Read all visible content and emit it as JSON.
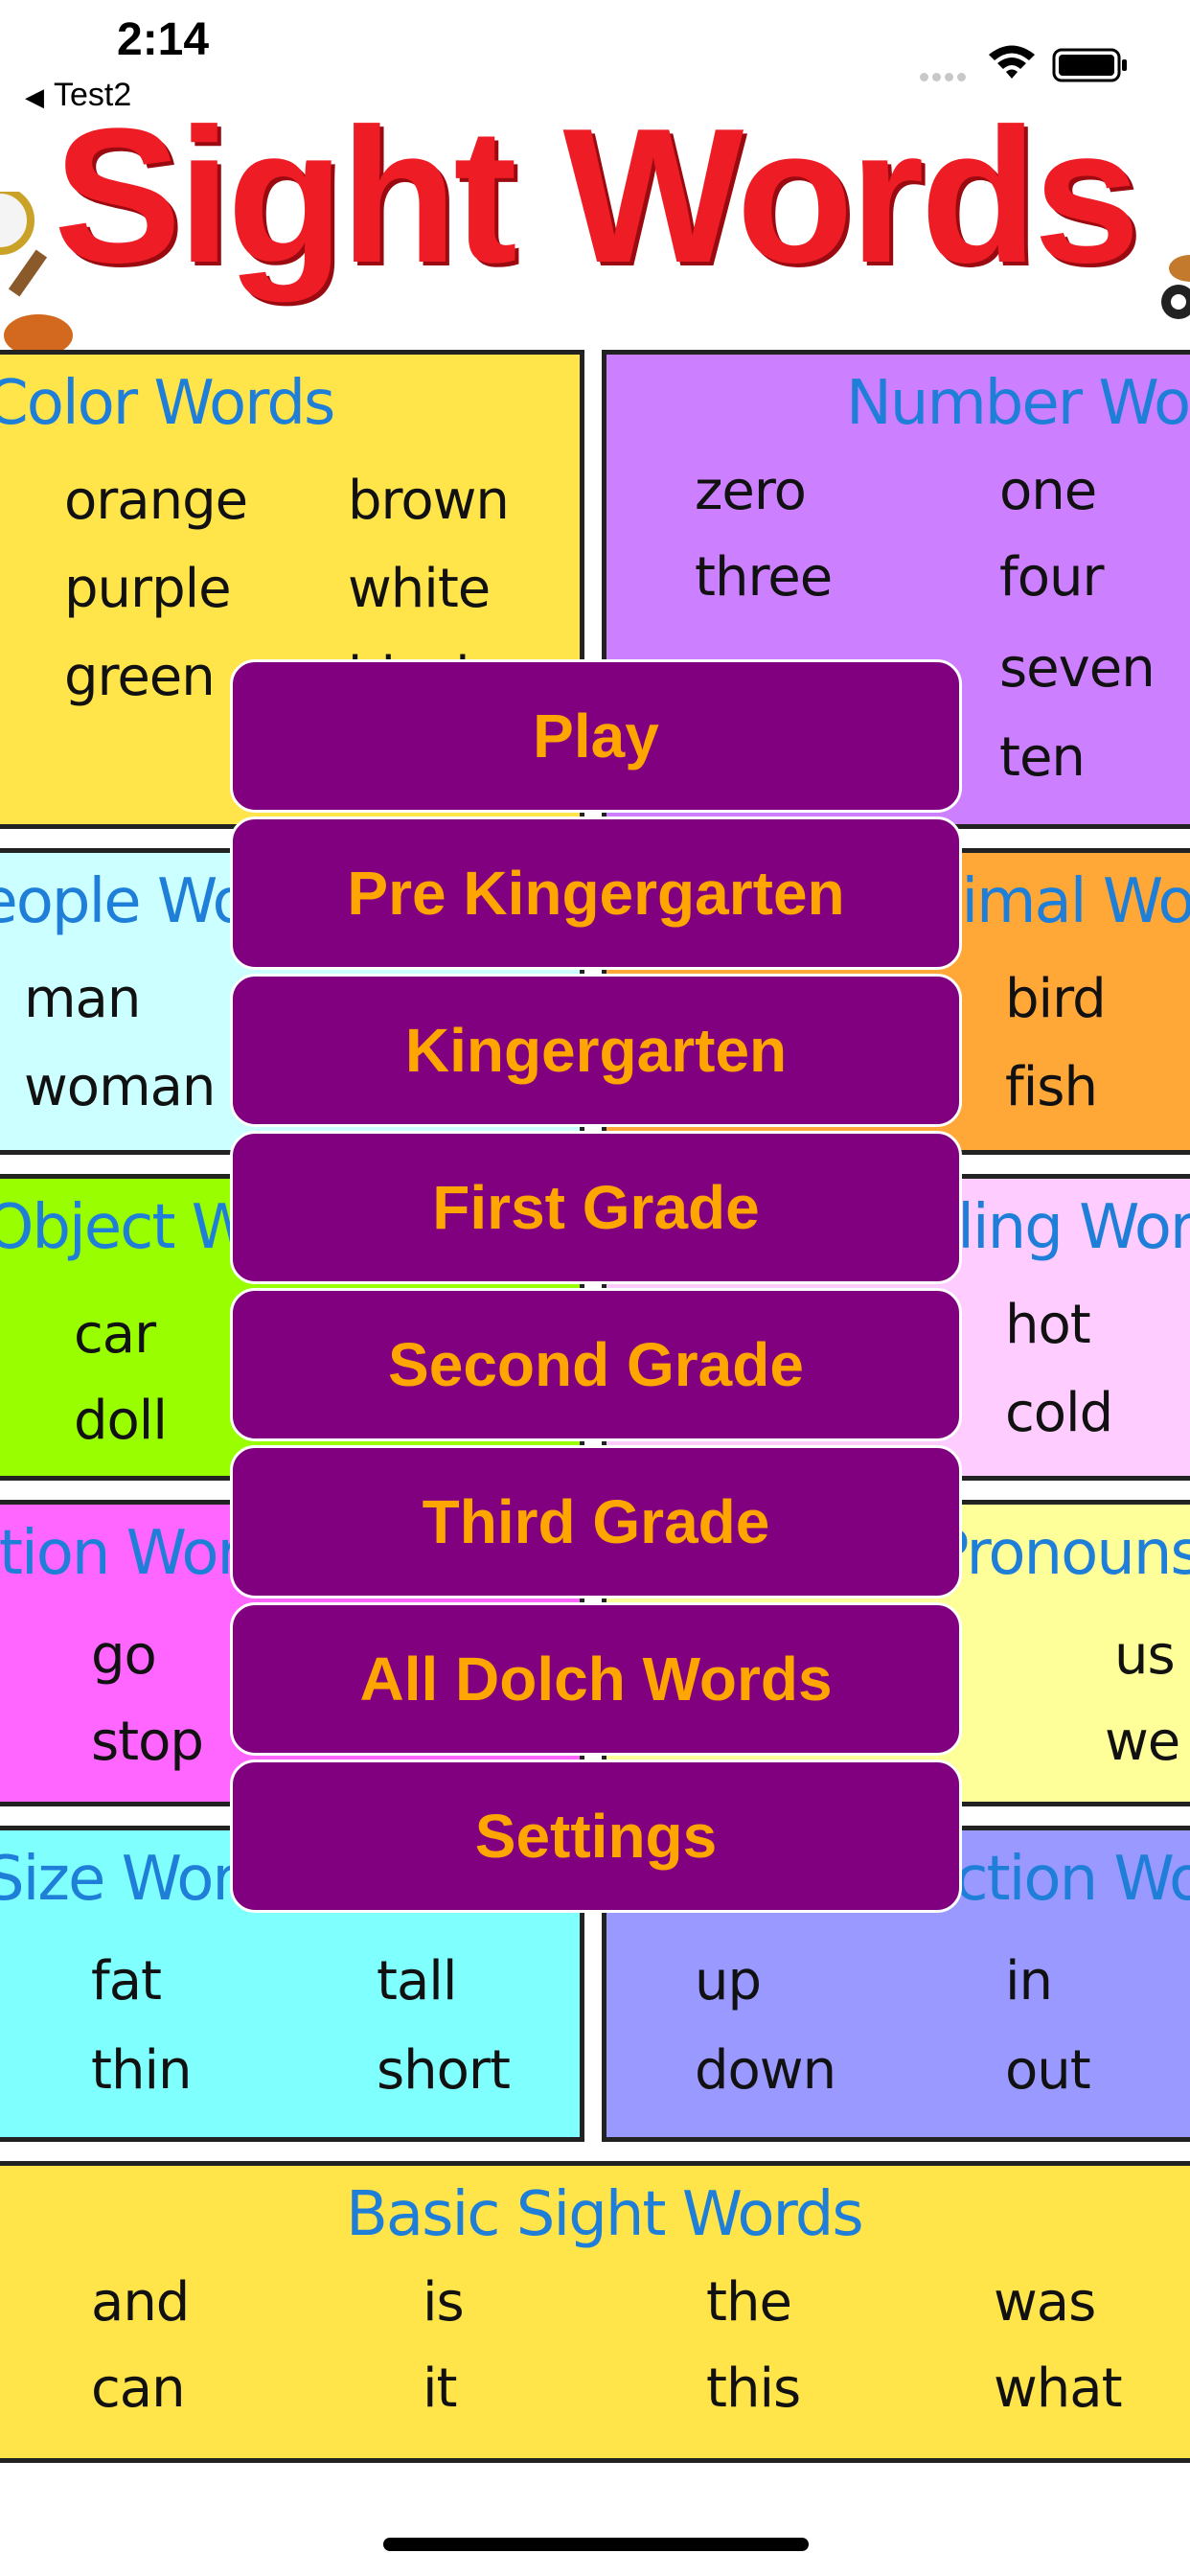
{
  "status_bar": {
    "time": "2:14",
    "back_label": "Test2",
    "back_arrow": "◀"
  },
  "poster": {
    "title": "Sight Words",
    "colors": {
      "title": "#ee1c24",
      "panel_title": "#1f7fd8"
    },
    "panels": {
      "color": {
        "title": "Color Words",
        "words": [
          "orange",
          "brown",
          "purple",
          "white",
          "green",
          "black"
        ]
      },
      "number": {
        "title": "Number Words",
        "words": [
          "zero",
          "one",
          "three",
          "four",
          "seven",
          "ten"
        ]
      },
      "people": {
        "title": "People Words",
        "words": [
          "man",
          "woman"
        ]
      },
      "animal": {
        "title": "Animal Words",
        "words": [
          "bird",
          "fish"
        ]
      },
      "object": {
        "title": "Object Words",
        "words": [
          "car",
          "doll"
        ]
      },
      "feeling": {
        "title": "Feeling Words",
        "words": [
          "hot",
          "cold"
        ]
      },
      "action": {
        "title": "Action Words",
        "words": [
          "go",
          "stop"
        ]
      },
      "pronouns": {
        "title": "Pronouns",
        "words": [
          "us",
          "we"
        ]
      },
      "size": {
        "title": "Size Words",
        "words": [
          "fat",
          "tall",
          "thin",
          "short"
        ]
      },
      "direction": {
        "title": "Direction Words",
        "words": [
          "up",
          "in",
          "down",
          "out"
        ]
      },
      "basic": {
        "title": "Basic Sight Words",
        "words": [
          "and",
          "is",
          "the",
          "was",
          "can",
          "it",
          "this",
          "what"
        ]
      }
    }
  },
  "menu": {
    "colors": {
      "background": "#800080",
      "text": "#ffa500",
      "border": "#ffffff"
    },
    "items": [
      {
        "label": "Play"
      },
      {
        "label": "Pre Kingergarten"
      },
      {
        "label": "Kingergarten"
      },
      {
        "label": "First Grade"
      },
      {
        "label": "Second Grade"
      },
      {
        "label": "Third Grade"
      },
      {
        "label": "All Dolch Words"
      },
      {
        "label": "Settings"
      }
    ]
  }
}
